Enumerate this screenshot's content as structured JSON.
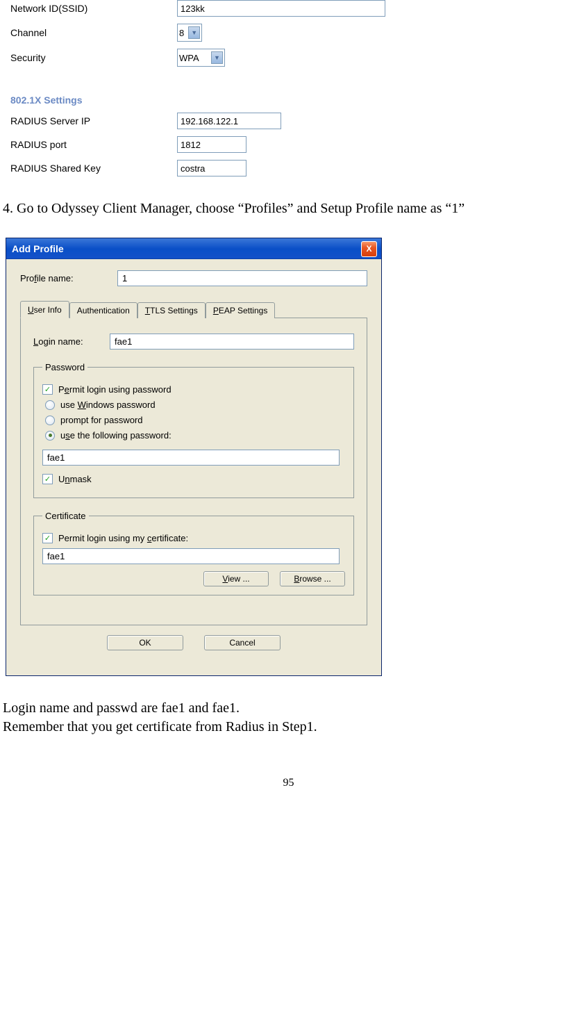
{
  "router": {
    "ssid_label": "Network ID(SSID)",
    "ssid_value": "123kk",
    "channel_label": "Channel",
    "channel_value": "8",
    "security_label": "Security",
    "security_value": "WPA",
    "section_8021x": "802.1X Settings",
    "radius_ip_label": "RADIUS Server IP",
    "radius_ip_value": "192.168.122.1",
    "radius_port_label": "RADIUS port",
    "radius_port_value": "1812",
    "radius_key_label": "RADIUS Shared Key",
    "radius_key_value": "costra"
  },
  "doc": {
    "step4": "4. Go to Odyssey Client Manager, choose “Profiles” and Setup Profile name as “1”",
    "after1": "Login name and passwd are fae1 and fae1.",
    "after2": "Remember that you get certificate from Radius in Step1.",
    "page_number": "95"
  },
  "dialog": {
    "title": "Add Profile",
    "close_x": "X",
    "profile_name_label_pre": "Pro",
    "profile_name_label_u": "f",
    "profile_name_label_post": "ile name:",
    "profile_name_value": "1",
    "tabs": {
      "user": {
        "u": "U",
        "post": "ser Info"
      },
      "auth": "Authentication",
      "ttls": {
        "u": "T",
        "post": "TLS Settings"
      },
      "peap": {
        "u": "P",
        "post": "EAP Settings"
      }
    },
    "login_label_u": "L",
    "login_label_post": "ogin name:",
    "login_value": "fae1",
    "password_group": "Password",
    "permit_login_pre": "P",
    "permit_login_u": "e",
    "permit_login_post": "rmit login using password",
    "use_windows_pre": "use ",
    "use_windows_u": "W",
    "use_windows_post": "indows password",
    "prompt_password": "prompt for password",
    "use_following_pre": "u",
    "use_following_u": "s",
    "use_following_post": "e the following password:",
    "password_value": "fae1",
    "unmask_pre": "U",
    "unmask_u": "n",
    "unmask_post": "mask",
    "certificate_group": "Certificate",
    "permit_cert_pre": "Permit login using my ",
    "permit_cert_u": "c",
    "permit_cert_post": "ertificate:",
    "cert_value": "fae1",
    "view_btn_u": "V",
    "view_btn_post": "iew ...",
    "browse_btn_u": "B",
    "browse_btn_post": "rowse ...",
    "ok_btn": "OK",
    "cancel_btn": "Cancel"
  }
}
